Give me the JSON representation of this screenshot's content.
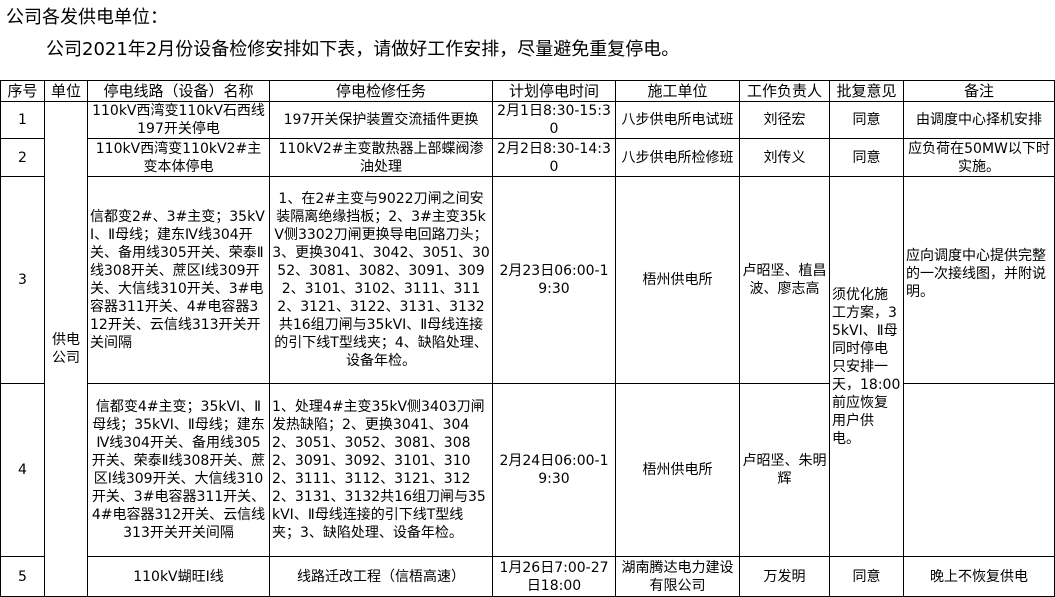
{
  "header": {
    "line1": "公司各发供电单位：",
    "line2": "公司2021年2月份设备检修安排如下表，请做好工作安排，尽量避免重复停电。"
  },
  "table": {
    "columns": [
      "序号",
      "单位",
      "停电线路（设备）名称",
      "停电检修任务",
      "计划停电时间",
      "施工单位",
      "工作负责人",
      "批复意见",
      "备注"
    ],
    "unit_merged": "供电公司",
    "approval_merged": "须优化施工方案，35kVⅠ、Ⅱ母同时停电只安排一天，18:00前应恢复用户供电。",
    "remark_merged": "应向调度中心提供完整的一次接线图，并附说明。",
    "rows": [
      {
        "no": "1",
        "line": "110kV西湾变110kV石西线197开关停电",
        "task": "197开关保护装置交流插件更换",
        "time": "2月1日8:30-15:30",
        "contractor": "八步供电所电试班",
        "leader": "刘径宏",
        "approval": "同意",
        "remark": "由调度中心择机安排"
      },
      {
        "no": "2",
        "line": "110kV西湾变110kV2#主变本体停电",
        "task": "110kV2#主变散热器上部蝶阀渗油处理",
        "time": "2月2日8:30-14:30",
        "contractor": "八步供电所检修班",
        "leader": "刘传义",
        "approval": "同意",
        "remark": "应负荷在50MW以下时实施。"
      },
      {
        "no": "3",
        "line": "信都变2#、3#主变；35kVⅠ、Ⅱ母线；建东Ⅳ线304开关、备用线305开关、荣泰Ⅱ线308开关、蔗区Ⅰ线309开关、大信线310开关、3#电容器311开关、4#电容器312开关、云信线313开关开关间隔",
        "task": "1、在2#主变与9022刀闸之间安装隔离绝缘挡板；2、3#主变35kV侧3302刀闸更换导电回路刀头；3、更换3041、3042、3051、3052、3081、3082、3091、3092、3101、3102、3111、3112、3121、3122、3131、3132共16组刀闸与35kVⅠ、Ⅱ母线连接的引下线T型线夹；4、缺陷处理、设备年检。",
        "time": "2月23日06:00-19:30",
        "contractor": "梧州供电所",
        "leader": "卢昭坚、植昌波、廖志高"
      },
      {
        "no": "4",
        "line": "信都变4#主变；35kVⅠ、Ⅱ母线；35kVⅠ、Ⅱ母线；建东Ⅳ线304开关、备用线305开关、荣泰Ⅱ线308开关、蔗区Ⅰ线309开关、大信线310开关、3#电容器311开关、4#电容器312开关、云信线313开关开关间隔",
        "task": "1、处理4#主变35kV侧3403刀闸发热缺陷；2、更换3041、3042、3051、3052、3081、3082、3091、3092、3101、3102、3111、3112、3121、3122、3131、3132共16组刀闸与35kVⅠ、Ⅱ母线连接的引下线T型线夹；3、缺陷处理、设备年检。",
        "time": "2月24日06:00-19:30",
        "contractor": "梧州供电所",
        "leader": "卢昭坚、朱明辉"
      },
      {
        "no": "5",
        "line": "110kV蝴旺Ⅰ线",
        "task": "线路迁改工程（信梧高速）",
        "time": "1月26日7:00-27日18:00",
        "contractor": "湖南腾达电力建设有限公司",
        "leader": "万发明",
        "approval": "同意",
        "remark": "晚上不恢复供电"
      }
    ]
  }
}
